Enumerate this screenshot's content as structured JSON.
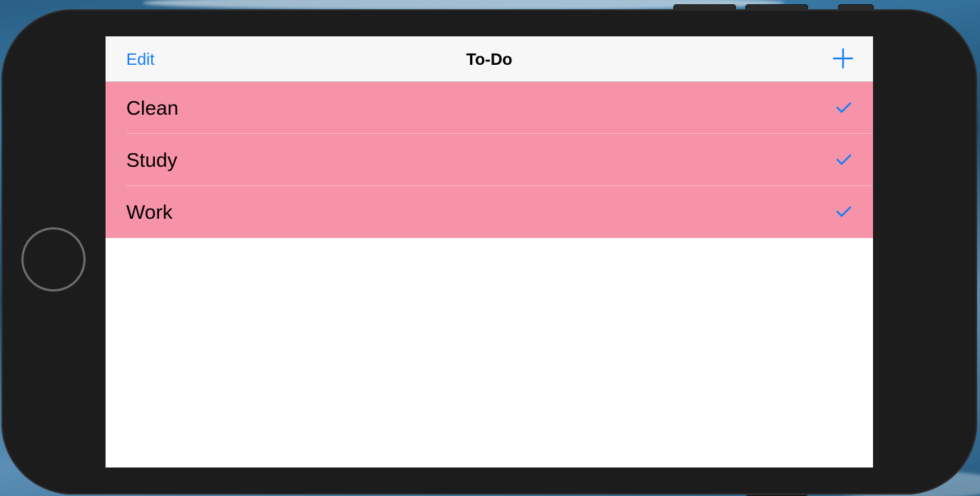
{
  "navbar": {
    "edit_label": "Edit",
    "title": "To-Do",
    "add_icon": "plus-icon"
  },
  "todo_items": [
    {
      "label": "Clean",
      "checked": true
    },
    {
      "label": "Study",
      "checked": true
    },
    {
      "label": "Work",
      "checked": true
    }
  ],
  "colors": {
    "accent": "#157efb",
    "row_background": "#f793a8",
    "navbar_background": "#f7f7f7",
    "device_frame": "#1c1c1c"
  }
}
